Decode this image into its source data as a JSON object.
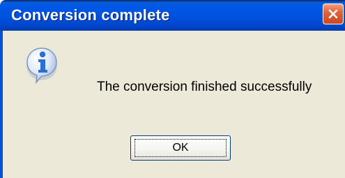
{
  "window": {
    "title": "Conversion complete",
    "close_icon": "close-icon"
  },
  "dialog": {
    "icon": "information-icon",
    "message": "The conversion finished successfully",
    "ok_label": "OK"
  },
  "colors": {
    "titlebar": "#0052e0",
    "client_background": "#ece9d8",
    "close_button": "#e1633a",
    "icon_blue": "#2a6fd6"
  }
}
